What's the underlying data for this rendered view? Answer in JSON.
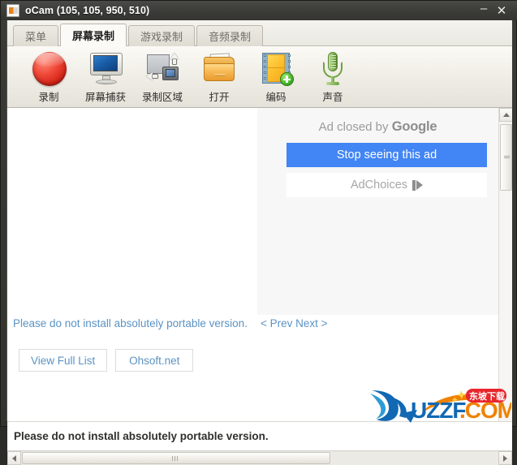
{
  "window": {
    "title": "oCam (105, 105, 950, 510)",
    "app_icon": "ocam-app-icon",
    "minimize_label": "–",
    "close_label": "✕"
  },
  "tabs": [
    {
      "label": "菜单",
      "active": false
    },
    {
      "label": "屏幕录制",
      "active": true
    },
    {
      "label": "游戏录制",
      "active": false
    },
    {
      "label": "音频录制",
      "active": false
    }
  ],
  "toolbar": {
    "items": [
      {
        "label": "录制",
        "icon": "record-circle-icon"
      },
      {
        "label": "屏幕捕获",
        "icon": "monitor-capture-icon"
      },
      {
        "label": "录制区域",
        "icon": "region-select-icon"
      },
      {
        "label": "打开",
        "icon": "open-folder-icon"
      },
      {
        "label": "编码",
        "icon": "film-encode-icon"
      },
      {
        "label": "声音",
        "icon": "microphone-icon"
      }
    ]
  },
  "ad": {
    "closed_prefix": "Ad closed by ",
    "brand": "Google",
    "stop_label": "Stop seeing this ad",
    "adchoices_label": "AdChoices",
    "adchoices_icon": "adchoices-triangle-icon",
    "accent_color": "#4285f4"
  },
  "notice": {
    "link_text": "Please do not install absolutely portable version.",
    "pager_text": "< Prev Next >",
    "link_color": "#5b93c4"
  },
  "buttons": [
    {
      "label": "View Full List"
    },
    {
      "label": "Ohsoft.net"
    }
  ],
  "statusbar": {
    "text": "Please do not install absolutely portable version."
  },
  "watermark": {
    "brand": "UZZF",
    "domain": ".COM",
    "badge": "东坡下载",
    "blue": "#1268b3",
    "orange": "#f08200",
    "red": "#e8262c"
  },
  "scrollbars": {
    "up_arrow": "scroll-up-arrow",
    "down_arrow": "scroll-down-arrow",
    "left_arrow": "scroll-left-arrow",
    "right_arrow": "scroll-right-arrow"
  }
}
